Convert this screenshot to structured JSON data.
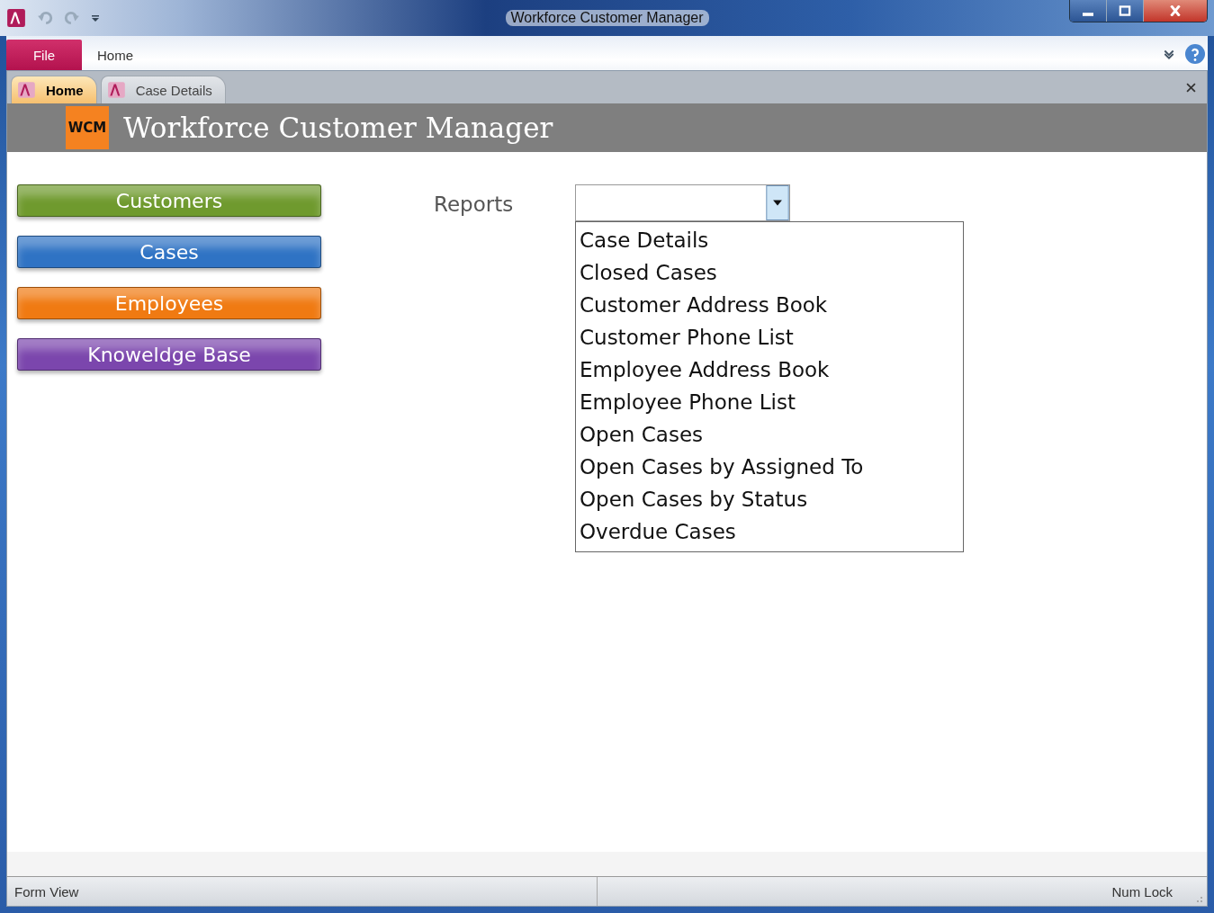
{
  "window": {
    "title": "Workforce Customer Manager"
  },
  "ribbon_tabs": [
    {
      "label": "File",
      "kind": "file",
      "selected": false
    },
    {
      "label": "Home",
      "kind": "tab",
      "selected": false
    }
  ],
  "document_tabs": [
    {
      "label": "Home",
      "selected": true
    },
    {
      "label": "Case Details",
      "selected": false
    }
  ],
  "header": {
    "logo": "WCM",
    "title": "Workforce Customer Manager"
  },
  "nav_buttons": [
    {
      "label": "Customers",
      "color": "#6f9a2e"
    },
    {
      "label": "Cases",
      "color": "#2f73c4"
    },
    {
      "label": "Employees",
      "color": "#f07a12"
    },
    {
      "label": "Knoweldge Base",
      "color": "#7b46ad"
    }
  ],
  "reports": {
    "label": "Reports",
    "expanded": true,
    "options": [
      {
        "label": "Case Details",
        "selected": false
      },
      {
        "label": "Closed Cases",
        "selected": false
      },
      {
        "label": "Customer Address Book",
        "selected": false
      },
      {
        "label": "Customer Phone List",
        "selected": false
      },
      {
        "label": "Employee Address Book",
        "selected": false
      },
      {
        "label": "Employee Phone List",
        "selected": false
      },
      {
        "label": "Open Cases",
        "selected": false
      },
      {
        "label": "Open Cases by Assigned To",
        "selected": false
      },
      {
        "label": "Open Cases by Status",
        "selected": false
      },
      {
        "label": "Overdue Cases",
        "selected": false
      }
    ]
  },
  "status_bar": {
    "left": "Form View",
    "right": "Num Lock"
  }
}
